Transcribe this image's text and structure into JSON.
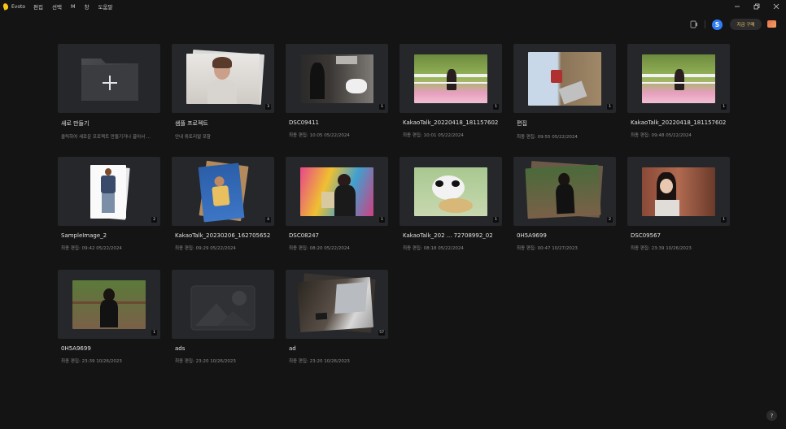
{
  "app": {
    "name": "Evoto"
  },
  "menu": [
    "편집",
    "선택",
    "M",
    "창",
    "도움말"
  ],
  "toolbar": {
    "avatar_letter": "S",
    "buy_label": "지금 구매"
  },
  "help_label": "?",
  "projects": [
    {
      "title": "새로 만들기",
      "subtitle": "클릭하여 새로운 프로젝트 만들기거나 끌어서 ...",
      "badge": ""
    },
    {
      "title": "샘플 프로젝트",
      "subtitle": "안내 튜토리얼 포함",
      "badge": "3"
    },
    {
      "title": "DSC09411",
      "subtitle": "최종 편집: 10:05 05/22/2024",
      "badge": "1"
    },
    {
      "title": "KakaoTalk_20220418_181157602",
      "subtitle": "최종 편집: 10:01 05/22/2024",
      "badge": "1"
    },
    {
      "title": "편집",
      "subtitle": "최종 편집: 09:55 05/22/2024",
      "badge": "1"
    },
    {
      "title": "KakaoTalk_20220418_181157602",
      "subtitle": "최종 편집: 09:48 05/22/2024",
      "badge": "1"
    },
    {
      "title": "SampleImage_2",
      "subtitle": "최종 편집: 09:42 05/22/2024",
      "badge": "2"
    },
    {
      "title": "KakaoTalk_20230206_162705652",
      "subtitle": "최종 편집: 09:29 05/22/2024",
      "badge": "4"
    },
    {
      "title": "DSC08247",
      "subtitle": "최종 편집: 08:20 05/22/2024",
      "badge": "1"
    },
    {
      "title": "KakaoTalk_202 ... 72708992_02",
      "subtitle": "최종 편집: 08:18 05/22/2024",
      "badge": "1"
    },
    {
      "title": "0H5A9699",
      "subtitle": "최종 편집: 00:47 10/27/2023",
      "badge": "2"
    },
    {
      "title": "DSC09567",
      "subtitle": "최종 편집: 23:39 10/26/2023",
      "badge": "1"
    },
    {
      "title": "0H5A9699",
      "subtitle": "최종 편집: 23:39 10/26/2023",
      "badge": "1"
    },
    {
      "title": "ads",
      "subtitle": "최종 편집: 23:20 10/26/2023",
      "badge": ""
    },
    {
      "title": "ad",
      "subtitle": "최종 편집: 23:20 10/26/2023",
      "badge": "57"
    }
  ]
}
